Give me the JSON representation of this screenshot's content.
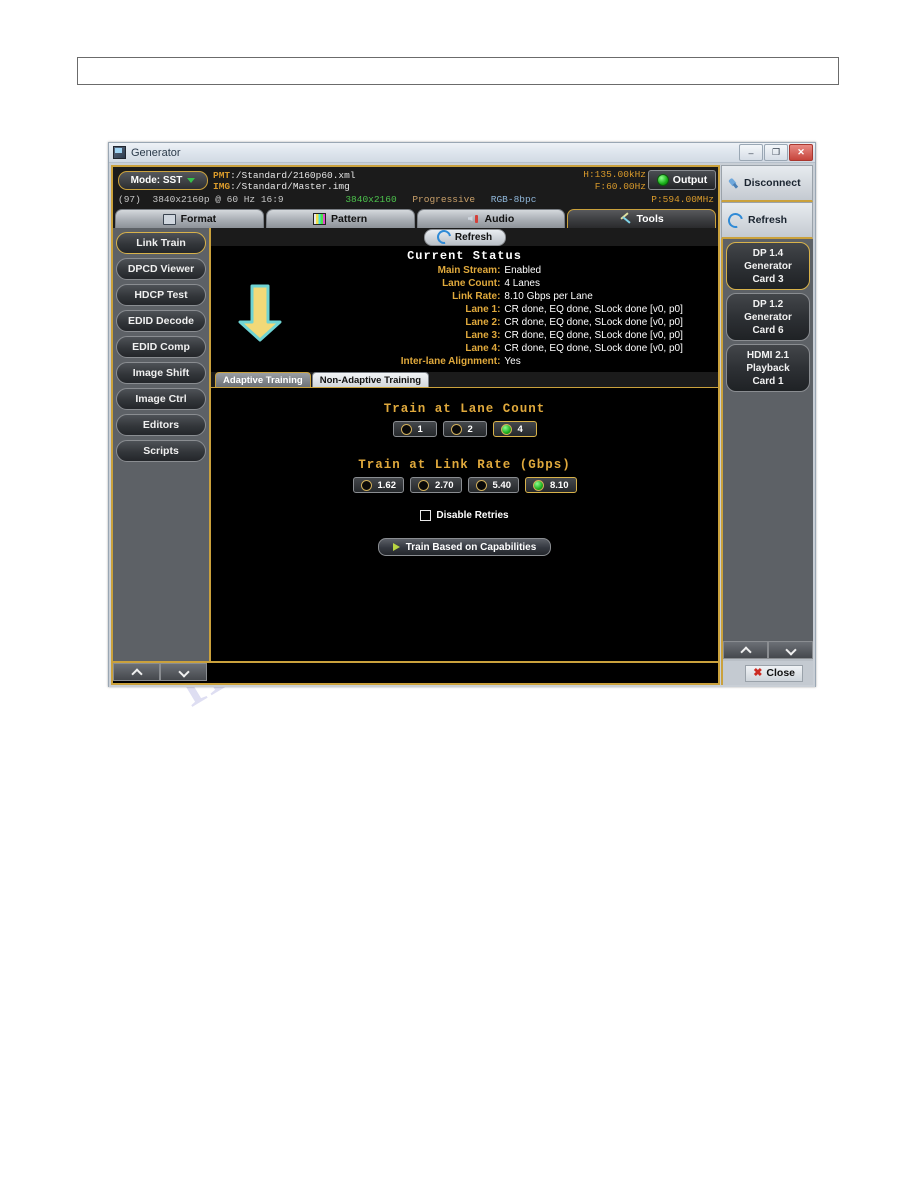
{
  "window": {
    "title": "Generator",
    "controls": {
      "minimize": "–",
      "maximize": "❐",
      "close": "✕"
    }
  },
  "info_header": {
    "mode_label": "Mode: SST",
    "pmt_label": "PMT",
    "pmt_value": ":/Standard/2160p60.xml",
    "img_label": "IMG",
    "img_value": ":/Standard/Master.img",
    "format_index": "(97)",
    "format_name": "3840x2160p @ 60 Hz 16:9",
    "resolution": "3840x2160",
    "scan": "Progressive",
    "color_depth": "RGB-8bpc",
    "h_freq": "H:135.00kHz",
    "f_freq": "F:60.00Hz",
    "p_clock": "P:594.00MHz",
    "output_label": "Output"
  },
  "top_tabs": [
    {
      "label": "Format",
      "icon": "monitor-icon",
      "active": false
    },
    {
      "label": "Pattern",
      "icon": "pattern-icon",
      "active": false
    },
    {
      "label": "Audio",
      "icon": "audio-icon",
      "active": false
    },
    {
      "label": "Tools",
      "icon": "tools-icon",
      "active": true
    }
  ],
  "side_nav": [
    {
      "label": "Link Train",
      "selected": true
    },
    {
      "label": "DPCD Viewer",
      "selected": false
    },
    {
      "label": "HDCP Test",
      "selected": false
    },
    {
      "label": "EDID Decode",
      "selected": false
    },
    {
      "label": "EDID Comp",
      "selected": false
    },
    {
      "label": "Image Shift",
      "selected": false
    },
    {
      "label": "Image Ctrl",
      "selected": false
    },
    {
      "label": "Editors",
      "selected": false
    },
    {
      "label": "Scripts",
      "selected": false
    }
  ],
  "main": {
    "refresh_label": "Refresh",
    "status_title": "Current Status",
    "status_rows": [
      {
        "label": "Main Stream:",
        "value": "Enabled"
      },
      {
        "label": "Lane Count:",
        "value": "4 Lanes"
      },
      {
        "label": "Link Rate:",
        "value": "8.10 Gbps per Lane"
      },
      {
        "label": "Lane 1:",
        "value": "CR done, EQ done, SLock done [v0, p0]"
      },
      {
        "label": "Lane 2:",
        "value": "CR done, EQ done, SLock done [v0, p0]"
      },
      {
        "label": "Lane 3:",
        "value": "CR done, EQ done, SLock done [v0, p0]"
      },
      {
        "label": "Lane 4:",
        "value": "CR done, EQ done, SLock done [v0, p0]"
      },
      {
        "label": "Inter-lane Alignment:",
        "value": "Yes"
      }
    ],
    "sub_tabs": [
      {
        "label": "Adaptive Training",
        "active": true
      },
      {
        "label": "Non-Adaptive Training",
        "active": false
      }
    ],
    "lane_count_title": "Train at Lane Count",
    "lane_count_options": [
      {
        "label": "1",
        "checked": false
      },
      {
        "label": "2",
        "checked": false
      },
      {
        "label": "4",
        "checked": true
      }
    ],
    "link_rate_title": "Train at Link Rate (Gbps)",
    "link_rate_options": [
      {
        "label": "1.62",
        "checked": false
      },
      {
        "label": "2.70",
        "checked": false
      },
      {
        "label": "5.40",
        "checked": false
      },
      {
        "label": "8.10",
        "checked": true
      }
    ],
    "disable_retries_label": "Disable Retries",
    "disable_retries_checked": false,
    "train_button_label": "Train Based on Capabilities"
  },
  "right_panel": {
    "disconnect_label": "Disconnect",
    "refresh_label": "Refresh",
    "cards": [
      {
        "line1": "DP 1.4",
        "line2": "Generator",
        "line3": "Card 3",
        "selected": true
      },
      {
        "line1": "DP 1.2",
        "line2": "Generator",
        "line3": "Card 6",
        "selected": false
      },
      {
        "line1": "HDMI 2.1",
        "line2": "Playback",
        "line3": "Card 1",
        "selected": false
      }
    ],
    "close_label": "Close"
  },
  "annotation": {
    "arrow": "down-arrow-callout",
    "arrow_fill": "#f2d978",
    "arrow_stroke": "#6fd4d4"
  },
  "page": {
    "watermark": "manualshire.com"
  },
  "colors": {
    "accent_gold": "#caa13c",
    "amber_text": "#e0a93c",
    "panel_black": "#000000",
    "led_green": "#19b019"
  }
}
